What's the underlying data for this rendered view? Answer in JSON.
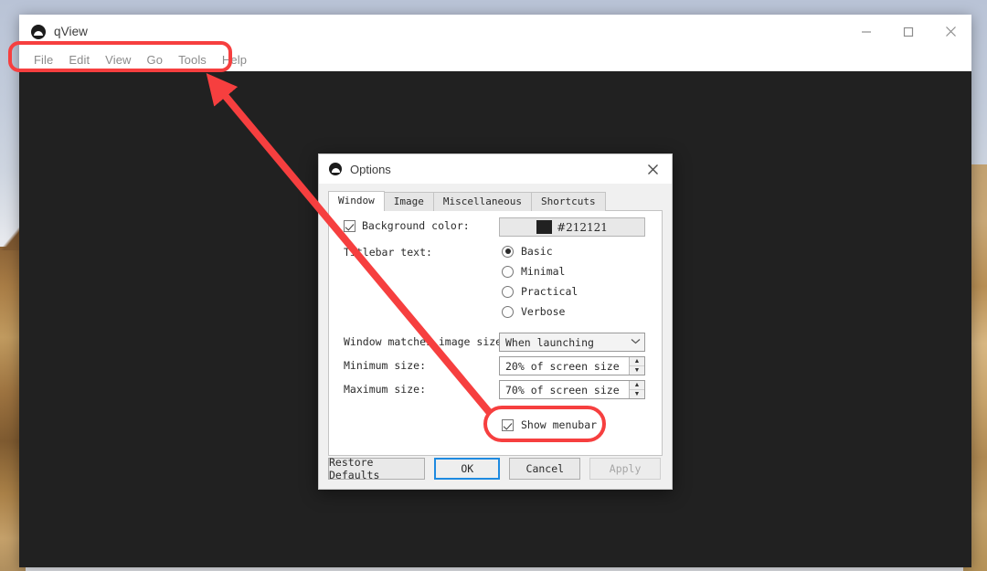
{
  "app": {
    "window_title": "qView",
    "logo_icon": "qview-cloud-icon",
    "window_controls": [
      {
        "name": "minimize",
        "icon": "minimize-icon"
      },
      {
        "name": "maximize",
        "icon": "maximize-icon"
      },
      {
        "name": "close",
        "icon": "close-icon"
      }
    ],
    "menubar": [
      {
        "label": "File"
      },
      {
        "label": "Edit"
      },
      {
        "label": "View"
      },
      {
        "label": "Go"
      },
      {
        "label": "Tools"
      },
      {
        "label": "Help"
      }
    ],
    "canvas_color": "#212121"
  },
  "dialog": {
    "title": "Options",
    "logo_icon": "qview-cloud-icon",
    "close_icon": "close-icon",
    "tabs": [
      {
        "label": "Window",
        "active": true
      },
      {
        "label": "Image",
        "active": false
      },
      {
        "label": "Miscellaneous",
        "active": false
      },
      {
        "label": "Shortcuts",
        "active": false
      }
    ],
    "window_tab": {
      "background_color": {
        "label": "Background color:",
        "checked": true,
        "swatch_hex": "#212121",
        "value_text": "#212121"
      },
      "titlebar_text": {
        "label": "Titlebar text:",
        "options": [
          {
            "label": "Basic",
            "selected": true
          },
          {
            "label": "Minimal",
            "selected": false
          },
          {
            "label": "Practical",
            "selected": false
          },
          {
            "label": "Verbose",
            "selected": false
          }
        ]
      },
      "window_matches_image_size": {
        "label": "Window matches image size:",
        "value": "When launching",
        "chevron": "chevron-down-icon"
      },
      "minimum_size": {
        "label": "Minimum size:",
        "value": "20% of screen size"
      },
      "maximum_size": {
        "label": "Maximum size:",
        "value": "70% of screen size"
      },
      "show_menubar": {
        "label": "Show menubar",
        "checked": true
      }
    },
    "buttons": {
      "restore_defaults": "Restore Defaults",
      "ok": "OK",
      "cancel": "Cancel",
      "apply": "Apply"
    }
  },
  "annotations": {
    "color": "#f63f3f",
    "highlight_menubar": "menubar-highlight-rectangle",
    "highlight_show_menubar": "show-menubar-highlight-oval",
    "arrow": "arrow-from-show-menubar-to-menubar"
  }
}
